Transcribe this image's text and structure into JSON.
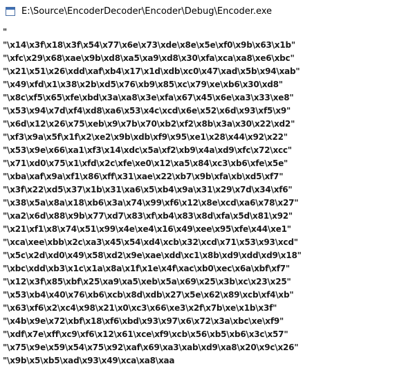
{
  "window": {
    "title": "E:\\Source\\EncoderDecoder\\Encoder\\Debug\\Encoder.exe",
    "icon": "console-app-icon"
  },
  "console": {
    "lines": [
      "\"",
      "\"\\x14\\x3f\\x18\\x3f\\x54\\x77\\x6e\\x73\\xde\\x8e\\x5e\\xf0\\x9b\\x63\\x1b\"",
      "\"\\xfc\\x29\\x68\\xae\\x9b\\xd8\\xa5\\xa9\\xd8\\x30\\xfa\\xca\\xa8\\xe6\\xbc\"",
      "\"\\x21\\x51\\x26\\xdd\\xaf\\xb4\\x17\\x1d\\xdb\\xc0\\x47\\xad\\x5b\\x94\\xab\"",
      "\"\\x49\\xfd\\x1\\x38\\x2b\\xd5\\x76\\xb9\\x85\\xc\\x79\\xe\\xb6\\x30\\xd8\"",
      "\"\\x8c\\xf5\\x65\\xfe\\xbd\\x3a\\xa8\\x3e\\xfa\\x67\\x45\\x6e\\xa3\\x33\\xe8\"",
      "\"\\x53\\x94\\x7d\\xf4\\xd8\\xa6\\x53\\x4c\\xcd\\x6e\\x52\\x6d\\x93\\xf5\\x9\"",
      "\"\\x6d\\x12\\x26\\x75\\xeb\\x9\\x7b\\x70\\xb2\\xf2\\x8b\\x3a\\x30\\x22\\xd2\"",
      "\"\\xf3\\x9a\\x5f\\x1f\\x2\\xe2\\x9b\\xdb\\xf9\\x95\\xe1\\x28\\x44\\x92\\x22\"",
      "\"\\x53\\x9e\\x66\\xa1\\xf3\\x14\\xdc\\x5a\\xf2\\xb9\\x4a\\xd9\\xfc\\x72\\xcc\"",
      "\"\\x71\\xd0\\x75\\x1\\xfd\\x2c\\xfe\\xe0\\x12\\xa5\\x84\\xc3\\xb6\\xfe\\x5e\"",
      "\"\\xba\\xaf\\x9a\\xf1\\x86\\xff\\x31\\xae\\x22\\xb7\\x9b\\xfa\\xb\\xd5\\xf7\"",
      "\"\\x3f\\x22\\xd5\\x37\\x1b\\x31\\xa6\\x5\\xb4\\x9a\\x31\\x29\\x7d\\x34\\xf6\"",
      "\"\\x38\\x5a\\x8a\\x18\\xb6\\x3a\\x74\\x99\\xf6\\x12\\x8e\\xcd\\xa6\\x78\\x27\"",
      "\"\\xa2\\x6d\\x88\\x9b\\x77\\xd7\\x83\\xf\\xb4\\x83\\x8d\\xfa\\x5d\\x81\\x92\"",
      "\"\\x21\\xf1\\x8\\x74\\x51\\x99\\x4e\\xe4\\x16\\x49\\xee\\x95\\xfe\\x44\\xe1\"",
      "\"\\xca\\xee\\xbb\\x2c\\xa3\\x45\\x54\\xd4\\xcb\\x32\\xcd\\x71\\x53\\x93\\xcd\"",
      "\"\\x5c\\x2d\\xd0\\x49\\x58\\xd2\\x9e\\xae\\xdd\\xc1\\x8b\\xd9\\xdd\\xd9\\x18\"",
      "\"\\xbc\\xdd\\xb3\\x1c\\x1a\\x8a\\x1f\\x1e\\x4f\\xac\\xb0\\xec\\x6a\\xbf\\xf7\"",
      "\"\\x12\\x3f\\x85\\xbf\\x25\\xa9\\xa5\\xeb\\x5a\\x69\\x25\\x3b\\xc\\x23\\x25\"",
      "\"\\x53\\xb4\\x40\\x76\\xb6\\xcb\\x8d\\xdb\\x27\\x5e\\x62\\x89\\xcb\\xf4\\xb\"",
      "\"\\x63\\xf6\\x2\\xc4\\x98\\x21\\x0\\xc3\\x66\\xe3\\x2f\\x7b\\xe\\x1b\\x3f\"",
      "\"\\x4b\\x9e\\x72\\xbf\\x18\\xf6\\xbd\\x93\\x97\\x6\\x72\\x3a\\xbc\\xe\\xf9\"",
      "\"\\xdf\\x7e\\xff\\xc9\\xf6\\x12\\x61\\xce\\xf9\\xcb\\x56\\xb5\\xb6\\x3c\\x57\"",
      "\"\\x75\\x9e\\x59\\x54\\x75\\x92\\xaf\\x69\\xa3\\xab\\xd9\\xa8\\x20\\x9c\\x26\"",
      "\"\\x9b\\x5\\xb5\\xad\\x93\\x49\\xca\\xa8\\xaa"
    ]
  }
}
